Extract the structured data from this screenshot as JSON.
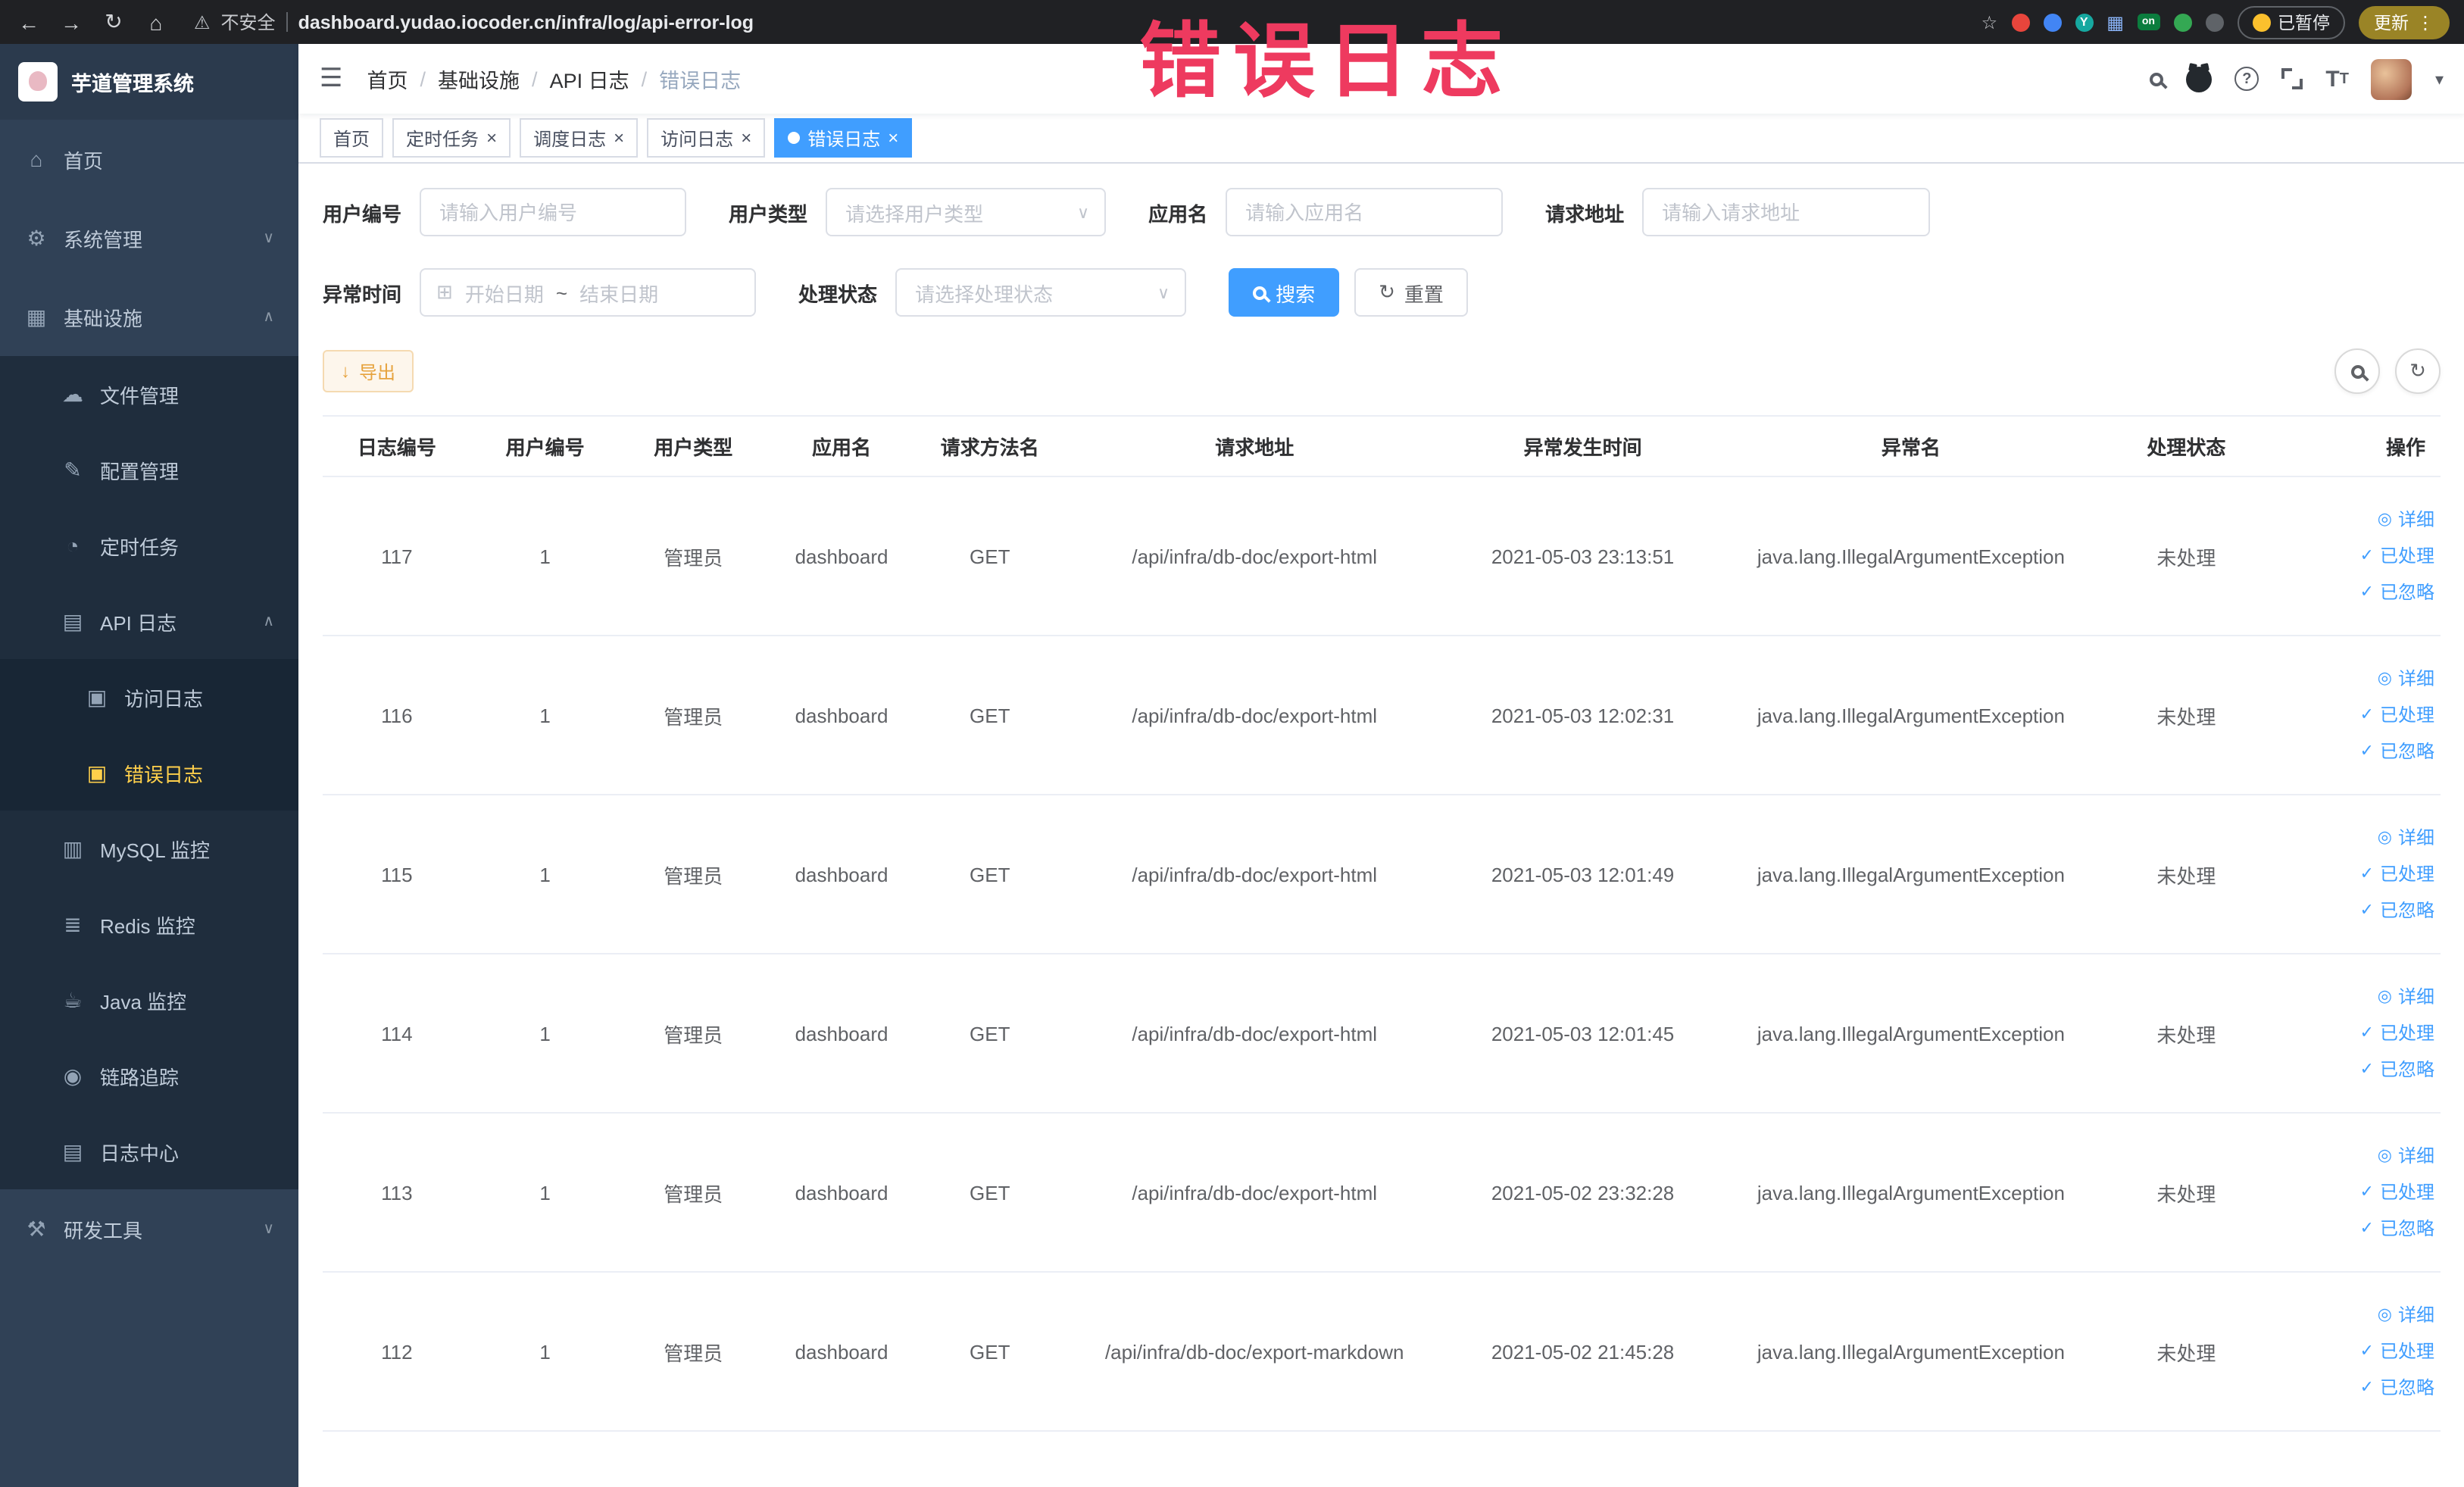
{
  "browser": {
    "security_label": "不安全",
    "url": "dashboard.yudao.iocoder.cn/infra/log/api-error-log",
    "paused_button": "已暂停",
    "update_button": "更新",
    "extension_on_badge": "on",
    "extension_y_badge": "Y"
  },
  "watermark": {
    "text": "错误日志"
  },
  "icons": {
    "back": "←",
    "forward": "→",
    "reload": "↻",
    "home_nav": "⌂",
    "warning": "⚠",
    "star": "☆",
    "menu_kebab": "⋮",
    "hamburger": "☰",
    "grid_ext": "▦",
    "home": "⌂",
    "gear": "⚙",
    "grid": "▦",
    "cloud": "☁",
    "edit": "✎",
    "clock": "◔",
    "doc": "▤",
    "log": "▣",
    "db": "▥",
    "layers": "≣",
    "coffee": "☕",
    "eye": "◉",
    "tools": "⚒",
    "chevron_down": "∨",
    "chevron_up": "∧",
    "select_arrow": "∨",
    "calendar": "⊞",
    "refresh": "↻",
    "download": "↓",
    "check": "✓",
    "eye_small": "◎",
    "caret": "▾",
    "close": "×",
    "breadcrumb_sep": "/"
  },
  "sidebar": {
    "logo_title": "芋道管理系统",
    "home": "首页",
    "system_mgmt": "系统管理",
    "infrastructure": "基础设施",
    "file_mgmt": "文件管理",
    "config_mgmt": "配置管理",
    "scheduled_jobs": "定时任务",
    "api_logs": "API 日志",
    "access_log": "访问日志",
    "error_log": "错误日志",
    "mysql_monitor": "MySQL 监控",
    "redis_monitor": "Redis 监控",
    "java_monitor": "Java 监控",
    "trace": "链路追踪",
    "log_center": "日志中心",
    "dev_tools": "研发工具"
  },
  "header": {
    "breadcrumb": [
      "首页",
      "基础设施",
      "API 日志",
      "错误日志"
    ]
  },
  "tabs": [
    {
      "label": "首页"
    },
    {
      "label": "定时任务"
    },
    {
      "label": "调度日志"
    },
    {
      "label": "访问日志"
    },
    {
      "label": "错误日志"
    }
  ],
  "filters": {
    "user_id_label": "用户编号",
    "user_id_placeholder": "请输入用户编号",
    "user_type_label": "用户类型",
    "user_type_placeholder": "请选择用户类型",
    "app_name_label": "应用名",
    "app_name_placeholder": "请输入应用名",
    "request_url_label": "请求地址",
    "request_url_placeholder": "请输入请求地址",
    "exception_time_label": "异常时间",
    "date_start_placeholder": "开始日期",
    "date_separator": "~",
    "date_end_placeholder": "结束日期",
    "process_status_label": "处理状态",
    "process_status_placeholder": "请选择处理状态",
    "search_button": "搜索",
    "reset_button": "重置"
  },
  "toolbar": {
    "export_button": "导出"
  },
  "table": {
    "columns": [
      "日志编号",
      "用户编号",
      "用户类型",
      "应用名",
      "请求方法名",
      "请求地址",
      "异常发生时间",
      "异常名",
      "处理状态",
      "操作"
    ],
    "rows": [
      [
        "117",
        "1",
        "管理员",
        "dashboard",
        "GET",
        "/api/infra/db-doc/export-html",
        "2021-05-03 23:13:51",
        "java.lang.IllegalArgumentException",
        "未处理"
      ],
      [
        "116",
        "1",
        "管理员",
        "dashboard",
        "GET",
        "/api/infra/db-doc/export-html",
        "2021-05-03 12:02:31",
        "java.lang.IllegalArgumentException",
        "未处理"
      ],
      [
        "115",
        "1",
        "管理员",
        "dashboard",
        "GET",
        "/api/infra/db-doc/export-html",
        "2021-05-03 12:01:49",
        "java.lang.IllegalArgumentException",
        "未处理"
      ],
      [
        "114",
        "1",
        "管理员",
        "dashboard",
        "GET",
        "/api/infra/db-doc/export-html",
        "2021-05-03 12:01:45",
        "java.lang.IllegalArgumentException",
        "未处理"
      ],
      [
        "113",
        "1",
        "管理员",
        "dashboard",
        "GET",
        "/api/infra/db-doc/export-html",
        "2021-05-02 23:32:28",
        "java.lang.IllegalArgumentException",
        "未处理"
      ],
      [
        "112",
        "1",
        "管理员",
        "dashboard",
        "GET",
        "/api/infra/db-doc/export-markdown",
        "2021-05-02 21:45:28",
        "java.lang.IllegalArgumentException",
        "未处理"
      ]
    ],
    "row_actions": [
      "详细",
      "已处理",
      "已忽略"
    ]
  }
}
